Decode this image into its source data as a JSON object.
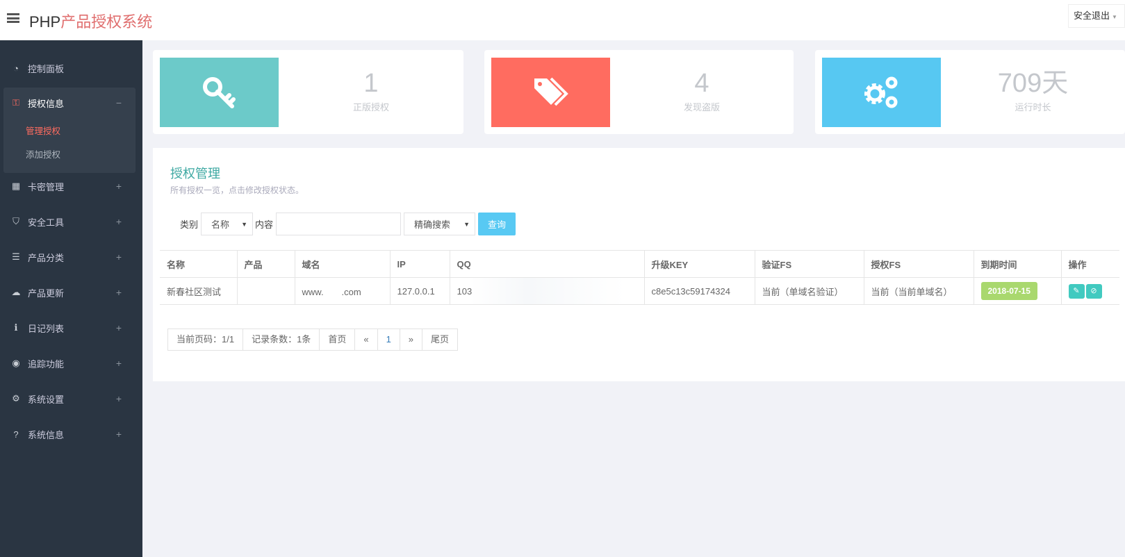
{
  "header": {
    "logo_prefix": "PHP",
    "logo_cn": "产品授权系统",
    "logout": "安全退出"
  },
  "sidebar": {
    "items": [
      {
        "label": "控制面板",
        "icon": "dashboard-icon",
        "glyph": "◔",
        "toggle": ""
      },
      {
        "label": "授权信息",
        "icon": "key-icon",
        "glyph": "⚿",
        "toggle": "−"
      },
      {
        "label": "卡密管理",
        "icon": "card-icon",
        "glyph": "▦",
        "toggle": "+"
      },
      {
        "label": "安全工具",
        "icon": "shield-icon",
        "glyph": "⛉",
        "toggle": "+"
      },
      {
        "label": "产品分类",
        "icon": "list-icon",
        "glyph": "☰",
        "toggle": "+"
      },
      {
        "label": "产品更新",
        "icon": "cloud-upload-icon",
        "glyph": "☁",
        "toggle": "+"
      },
      {
        "label": "日记列表",
        "icon": "info-icon",
        "glyph": "ℹ",
        "toggle": "+"
      },
      {
        "label": "追踪功能",
        "icon": "target-icon",
        "glyph": "◉",
        "toggle": "+"
      },
      {
        "label": "系统设置",
        "icon": "gears-icon",
        "glyph": "⚙",
        "toggle": "+"
      },
      {
        "label": "系统信息",
        "icon": "question-icon",
        "glyph": "?",
        "toggle": "+"
      }
    ],
    "sub_items": [
      {
        "label": "管理授权",
        "active": true
      },
      {
        "label": "添加授权",
        "active": false
      }
    ]
  },
  "stats": [
    {
      "value": "1",
      "label": "正版授权",
      "icon": "key-icon",
      "color": "#6ccac9"
    },
    {
      "value": "4",
      "label": "发现盗版",
      "icon": "tags-icon",
      "color": "#ff6c60"
    },
    {
      "value": "709天",
      "label": "运行时长",
      "icon": "gears-icon",
      "color": "#57c8f2"
    }
  ],
  "panel": {
    "title": "授权管理",
    "subtitle": "所有授权一览，点击修改授权状态。",
    "search": {
      "category_label": "类别",
      "category_value": "名称",
      "content_label": "内容",
      "content_value": "",
      "mode_value": "精确搜索",
      "button": "查询"
    },
    "columns": [
      "名称",
      "产品",
      "域名",
      "IP",
      "QQ",
      "升级KEY",
      "验证FS",
      "授权FS",
      "到期时间",
      "操作"
    ],
    "rows": [
      {
        "name": "新春社区测试",
        "product": "",
        "domain": "www.　　.com",
        "ip": "127.0.0.1",
        "qq": "103",
        "key": "c8e5c13c59174324",
        "verify_fs": "当前（单域名验证）",
        "auth_fs": "当前（当前单域名）",
        "expire": "2018-07-15"
      }
    ],
    "pager": {
      "current": "当前页码：1/1",
      "records": "记录条数：1条",
      "first": "首页",
      "prev": "«",
      "page": "1",
      "next": "»",
      "last": "尾页"
    }
  }
}
